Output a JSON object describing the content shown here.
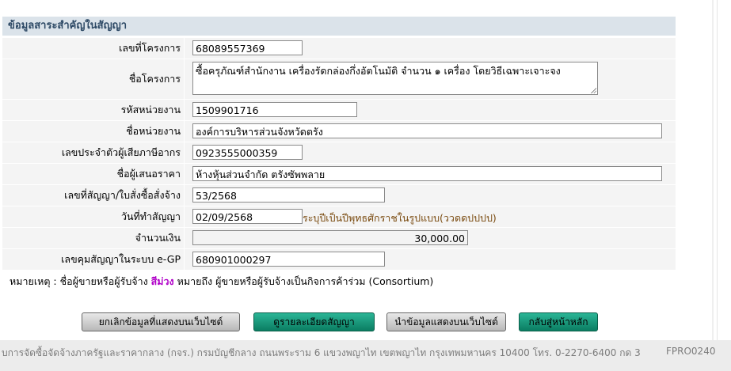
{
  "panel": {
    "title": "ข้อมูลสาระสำคัญในสัญญา"
  },
  "fields": {
    "project_no": {
      "label": "เลขที่โครงการ",
      "value": "68089557369"
    },
    "project_name": {
      "label": "ชื่อโครงการ",
      "value": "ซื้อครุภัณฑ์สำนักงาน เครื่องรัดกล่องกึ่งอัตโนมัติ  จำนวน  ๑  เครื่อง โดยวิธีเฉพาะเจาะจง"
    },
    "agency_code": {
      "label": "รหัสหน่วยงาน",
      "value": "1509901716"
    },
    "agency_name": {
      "label": "ชื่อหน่วยงาน",
      "value": "องค์การบริหารส่วนจังหวัดตรัง"
    },
    "tax_id": {
      "label": "เลขประจำตัวผู้เสียภาษีอากร",
      "value": "0923555000359"
    },
    "bidder": {
      "label": "ชื่อผู้เสนอราคา",
      "value": "ห้างหุ้นส่วนจำกัด ตรังซัพพลาย"
    },
    "contract_no": {
      "label": "เลขที่สัญญา/ใบสั่งซื้อสั่งจ้าง",
      "value": "53/2568"
    },
    "contract_date": {
      "label": "วันที่ทำสัญญา",
      "value": "02/09/2568",
      "hint": "ระบุปีเป็นปีพุทธศักราชในรูปแบบ(ววดดปปปป)"
    },
    "amount": {
      "label": "จำนวนเงิน",
      "value": "30,000.00"
    },
    "egp_no": {
      "label": "เลขคุมสัญญาในระบบ e-GP",
      "value": "680901000297"
    }
  },
  "note": {
    "prefix": "หมายเหตุ : ชื่อผู้ขายหรือผู้รับจ้าง ",
    "highlight": "สีม่วง",
    "suffix": " หมายถึง ผู้ขายหรือผู้รับจ้างเป็นกิจการค้าร่วม (Consortium)"
  },
  "buttons": {
    "cancel_display": "ยกเลิกข้อมูลที่แสดงบนเว็บไซต์",
    "contract_detail": "ดูรายละเอียดสัญญา",
    "publish": "นำข้อมูลแสดงบนเว็บไซต์",
    "back_home": "กลับสู่หน้าหลัก"
  },
  "footer": {
    "address": "บการจัดซื้อจัดจ้างภาครัฐและราคากลาง (กจร.) กรมบัญชีกลาง ถนนพระราม 6 แขวงพญาไท เขตพญาไท กรุงเทพมหานคร 10400 โทร. 0-2270-6400 กด 3",
    "page_code": "FPRO0240"
  },
  "colors": {
    "header_bg": "#dbe3ea",
    "teal_button": "#1a9a7c",
    "consortium": "#b000c8"
  }
}
